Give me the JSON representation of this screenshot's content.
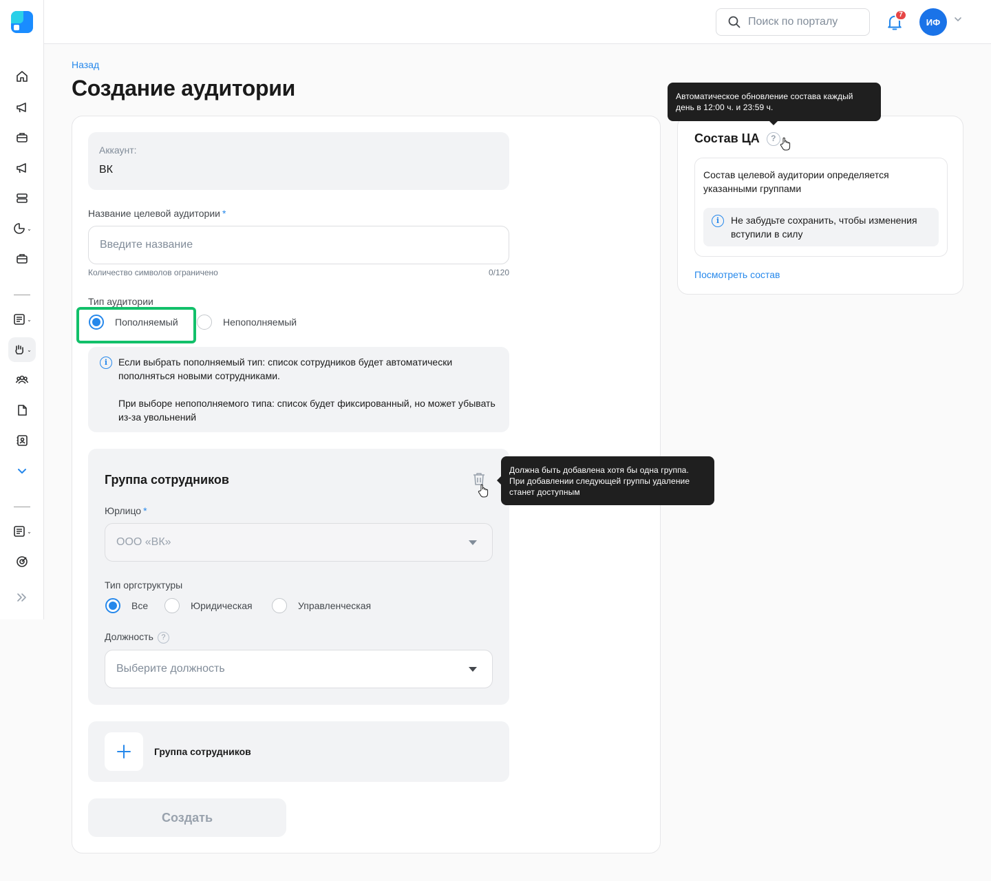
{
  "header": {
    "search_placeholder": "Поиск по порталу",
    "notifications_count": "7",
    "user_initials": "ИФ"
  },
  "page": {
    "back_label": "Назад",
    "title": "Создание аудитории"
  },
  "form": {
    "account_label": "Аккаунт:",
    "account_value": "ВК",
    "name_label": "Название целевой аудитории",
    "required_mark": "*",
    "name_placeholder": "Введите название",
    "name_hint": "Количество символов ограничено",
    "name_counter": "0/120",
    "type_label": "Тип аудитории",
    "type_options": [
      {
        "label": "Пополняемый",
        "selected": true
      },
      {
        "label": "Непополняемый",
        "selected": false
      }
    ],
    "info_line1": "Если выбрать пополняемый тип: список сотрудников будет автоматически пополняться новыми сотрудниками.",
    "info_line2": "При выборе непополняемого типа: список будет фиксированный, но может убывать из-за увольнений",
    "group": {
      "title": "Группа сотрудников",
      "legal_label": "Юрлицо",
      "legal_value": "ООО «ВК»",
      "org_type_label": "Тип оргструктуры",
      "org_options": [
        {
          "label": "Все",
          "selected": true
        },
        {
          "label": "Юридическая",
          "selected": false
        },
        {
          "label": "Управленческая",
          "selected": false
        }
      ],
      "position_label": "Должность",
      "position_placeholder": "Выберите должность"
    },
    "add_group_label": "Группа сотрудников",
    "create_label": "Создать"
  },
  "side": {
    "title": "Состав ЦА",
    "description": "Состав целевой аудитории определяется указанными группами",
    "note": "Не забудьте сохранить, чтобы изменения вступили в силу",
    "link": "Посмотреть состав"
  },
  "tooltips": {
    "auto_update": "Автоматическое обновление состава каждый день в 12:00 ч. и 23:59 ч.",
    "delete_group": "Должна быть добавлена хотя бы одна группа. При добавлении следующей группы удаление станет доступным"
  },
  "colors": {
    "accent": "#2688eb",
    "highlight": "#12c06a",
    "tooltip_bg": "#1f1f1f",
    "badge": "#e64646"
  }
}
